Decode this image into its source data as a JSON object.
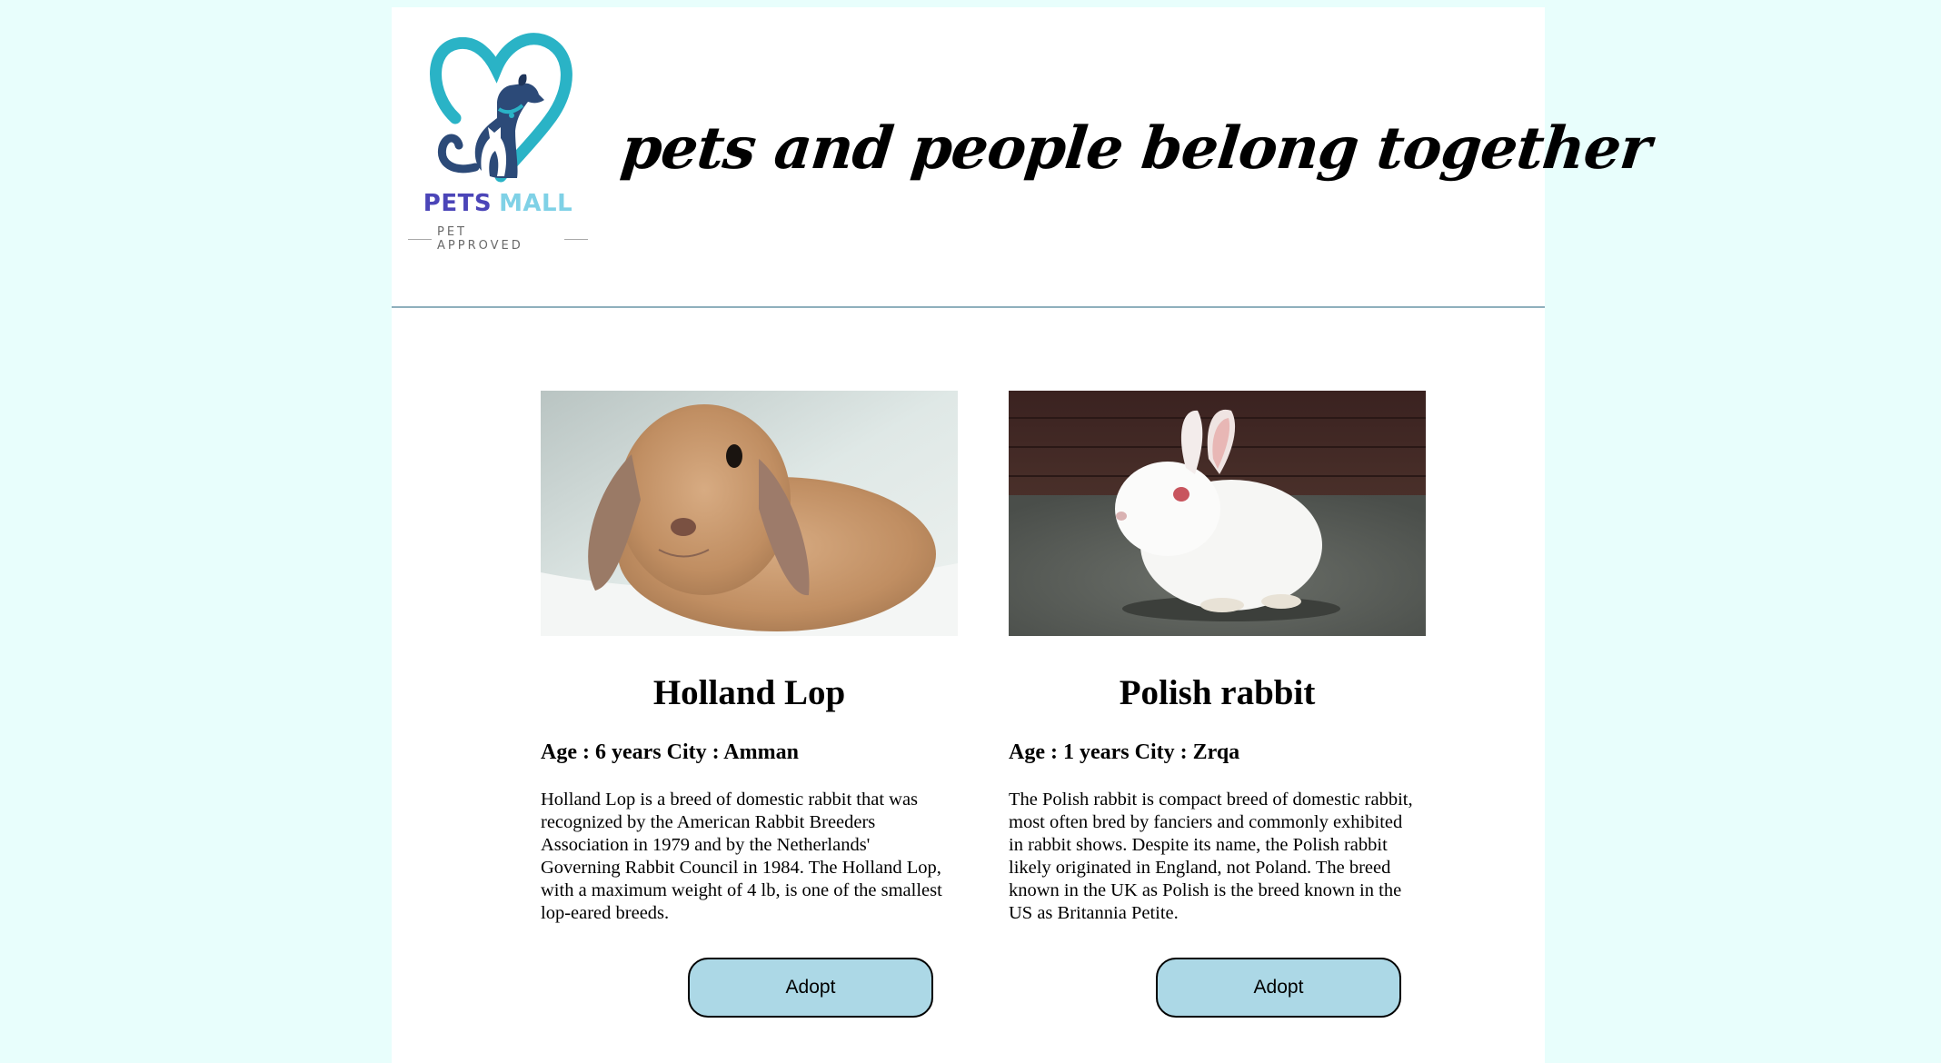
{
  "header": {
    "logo": {
      "word1": "PETS",
      "word2": "MALL",
      "subtitle": "PET APPROVED",
      "colors": {
        "heart": "#2ab3c6",
        "dog": "#2c4a78",
        "pets": "#4b45b8",
        "mall": "#7fd1e6"
      }
    },
    "tagline": "pets and people belong together"
  },
  "pets": [
    {
      "name": "Holland Lop",
      "meta": "Age : 6 years City : Amman",
      "description": "Holland Lop is a breed of domestic rabbit that was recognized by the American Rabbit Breeders Association in 1979 and by the Netherlands' Governing Rabbit Council in 1984. The Holland Lop, with a maximum weight of 4 lb, is one of the smallest lop-eared breeds.",
      "adopt_label": "Adopt"
    },
    {
      "name": "Polish rabbit",
      "meta": "Age : 1 years City : Zrqa",
      "description": "The Polish rabbit is compact breed of domestic rabbit, most often bred by fanciers and commonly exhibited in rabbit shows. Despite its name, the Polish rabbit likely originated in England, not Poland. The breed known in the UK as Polish is the breed known in the US as Britannia Petite.",
      "adopt_label": "Adopt"
    }
  ],
  "colors": {
    "page_background": "#e8fefc",
    "button_background": "#acd8e6",
    "divider": "#8fb0bd"
  }
}
